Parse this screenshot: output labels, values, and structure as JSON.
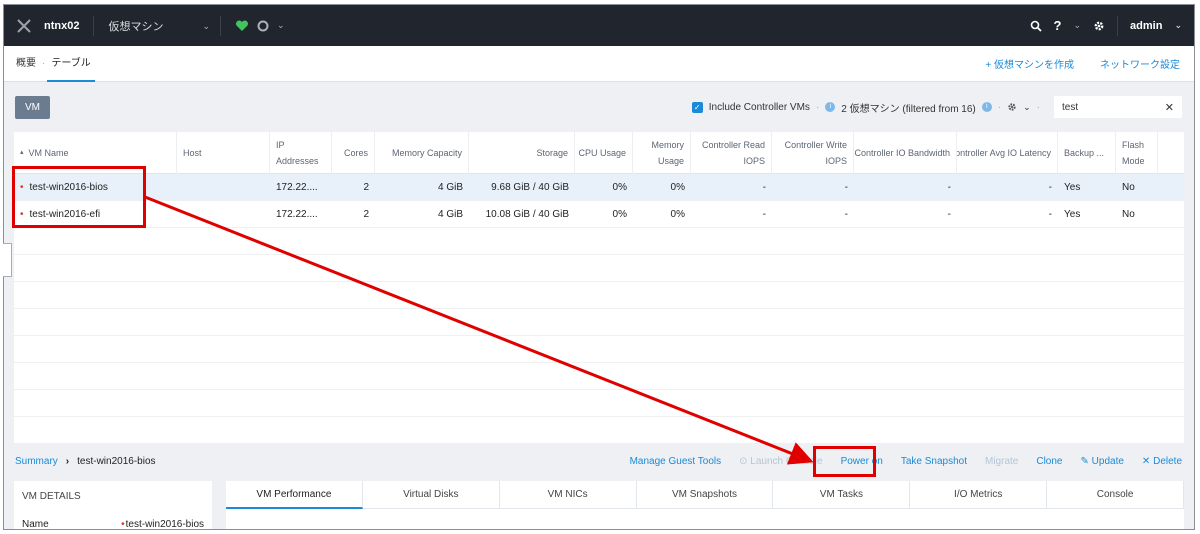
{
  "topbar": {
    "cluster": "ntnx02",
    "section": "仮想マシン",
    "user": "admin",
    "help": "?"
  },
  "subnav": {
    "tabs": [
      "概要",
      "テーブル"
    ],
    "links": [
      "+ 仮想マシンを作成",
      "ネットワーク設定"
    ]
  },
  "toolbar": {
    "vm_button": "VM",
    "include_label": "Include Controller VMs",
    "count_text": "2 仮想マシン (filtered from 16)",
    "search_value": "test"
  },
  "table": {
    "headers": [
      "VM Name",
      "Host",
      "IP Addresses",
      "Cores",
      "Memory Capacity",
      "Storage",
      "CPU Usage",
      "Memory Usage",
      "Controller Read IOPS",
      "Controller Write IOPS",
      "Controller IO Bandwidth",
      "Controller Avg IO Latency",
      "Backup ...",
      "Flash Mode"
    ],
    "rows": [
      [
        "test-win2016-bios",
        "",
        "172.22....",
        "2",
        "4 GiB",
        "9.68 GiB / 40 GiB",
        "0%",
        "0%",
        "-",
        "-",
        "-",
        "-",
        "Yes",
        "No"
      ],
      [
        "test-win2016-efi",
        "",
        "172.22....",
        "2",
        "4 GiB",
        "10.08 GiB / 40 GiB",
        "0%",
        "0%",
        "-",
        "-",
        "-",
        "-",
        "Yes",
        "No"
      ]
    ]
  },
  "bottom": {
    "crumb_link": "Summary",
    "crumb_current": "test-win2016-bios",
    "actions": [
      "Manage Guest Tools",
      "Launch Console",
      "Power on",
      "Take Snapshot",
      "Migrate",
      "Clone",
      "Update",
      "Delete"
    ],
    "details_title": "VM DETAILS",
    "details_key": "Name",
    "details_value": "test-win2016-bios",
    "tabs": [
      "VM Performance",
      "Virtual Disks",
      "VM NICs",
      "VM Snapshots",
      "VM Tasks",
      "I/O Metrics",
      "Console"
    ]
  },
  "colors": {
    "accent": "#1b8ad8",
    "topbar": "#21262e",
    "annotation": "#e00000",
    "health": "#3fc55b"
  }
}
